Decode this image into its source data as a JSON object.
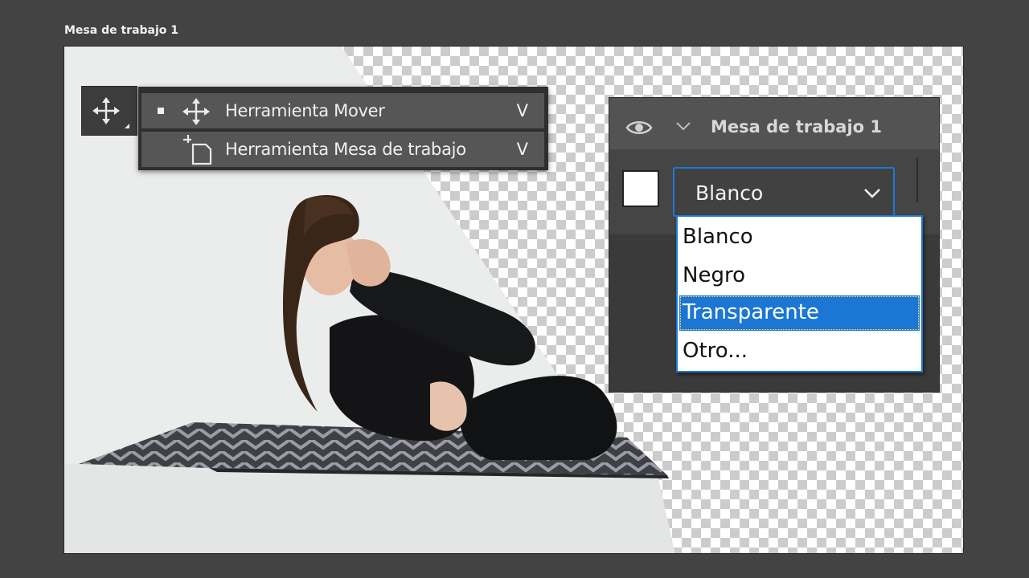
{
  "artboard": {
    "title": "Mesa de trabajo 1"
  },
  "toolbar": {
    "active_tool_icon": "move-icon",
    "flyout": [
      {
        "label": "Herramienta Mover",
        "shortcut": "V",
        "icon": "move-icon",
        "selected": true
      },
      {
        "label": "Herramienta Mesa de trabajo",
        "shortcut": "V",
        "icon": "artboard-icon",
        "selected": false
      }
    ]
  },
  "panel": {
    "title": "Mesa de trabajo 1",
    "eye_icon": "eye-icon",
    "swatch_color": "#ffffff",
    "background_select": {
      "value": "Blanco",
      "options": [
        "Blanco",
        "Negro",
        "Transparente",
        "Otro..."
      ],
      "highlighted": "Transparente"
    }
  },
  "colors": {
    "accent": "#1c76d3",
    "workspace": "#434343",
    "panel": "#3a3a3a",
    "panel_header": "#535353",
    "flyout_item": "#565656"
  }
}
